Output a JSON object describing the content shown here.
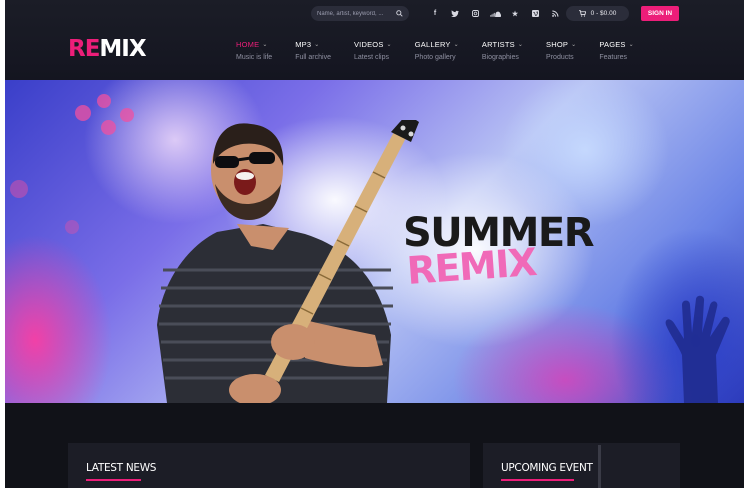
{
  "topbar": {
    "search_placeholder": "Name, artist, keyword, ...",
    "social_icons": [
      "facebook-icon",
      "twitter-icon",
      "instagram-icon",
      "soundcloud-icon",
      "star-icon",
      "vimeo-icon",
      "rss-icon"
    ],
    "cart_label": "0 - $0.00",
    "signin_label": "SIGN IN"
  },
  "logo": {
    "part1": "RE",
    "part2": "MIX"
  },
  "nav": [
    {
      "label": "HOME",
      "sub": "Music is life",
      "active": true
    },
    {
      "label": "MP3",
      "sub": "Full archive"
    },
    {
      "label": "VIDEOS",
      "sub": "Latest clips"
    },
    {
      "label": "GALLERY",
      "sub": "Photo gallery"
    },
    {
      "label": "ARTISTS",
      "sub": "Biographies"
    },
    {
      "label": "SHOP",
      "sub": "Products"
    },
    {
      "label": "PAGES",
      "sub": "Features"
    }
  ],
  "hero": {
    "title": "SUMMER",
    "subtitle": "REMIX"
  },
  "sections": {
    "news_title": "LATEST NEWS",
    "events_title": "UPCOMING EVENT"
  },
  "colors": {
    "accent": "#ec1e79",
    "hero_pink": "#f06ab8",
    "bg_dark": "#0e0f14"
  }
}
